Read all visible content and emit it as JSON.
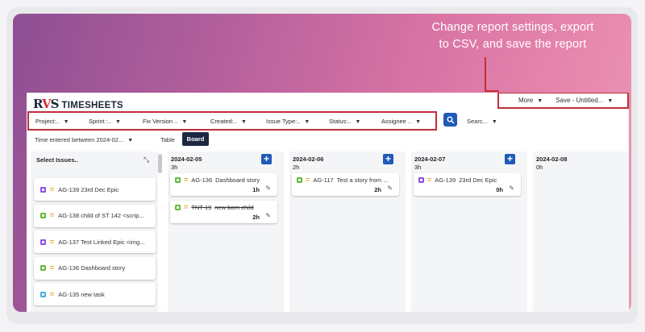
{
  "callout": {
    "line1": "Change report settings, export",
    "line2": "to CSV, and save the report"
  },
  "app": {
    "logo_mark": "RVS",
    "logo_text": "TIMESHEETS",
    "more_label": "More",
    "save_label": "Save - Untitled..."
  },
  "filters": [
    "Project:..",
    "Sprint :..",
    "Fix Version ..",
    "Created:..",
    "Issue Type:..",
    "Status:..",
    "Assignee .."
  ],
  "search_select": "Searc...",
  "time_filter": "Time entered between 2024-02...",
  "views": {
    "table": "Table",
    "board": "Board"
  },
  "issues_panel": {
    "title": "Select Issues..",
    "items": [
      {
        "text": "AG-139 23rd Dec Epic",
        "type_color": "#904ee2"
      },
      {
        "text": "AG-138 child of ST 142 <scrip...",
        "type_color": "#63ba3c"
      },
      {
        "text": "AG-137 Test Linked Epic <img...",
        "type_color": "#904ee2"
      },
      {
        "text": "AG-136 Dashboard story",
        "type_color": "#63ba3c"
      },
      {
        "text": "AG-135 new task",
        "type_color": "#4bade8"
      }
    ]
  },
  "columns": [
    {
      "date": "2024-02-05",
      "total": "3h",
      "cards": [
        {
          "id": "AG-136",
          "title": "Dashboard story",
          "time": "1h",
          "type_color": "#63ba3c",
          "strike": false
        },
        {
          "id": "TNT-19",
          "title": "new born child",
          "time": "2h",
          "type_color": "#63ba3c",
          "strike": true
        }
      ]
    },
    {
      "date": "2024-02-06",
      "total": "2h",
      "cards": [
        {
          "id": "AG-117",
          "title": "Test a story from ...",
          "time": "2h",
          "type_color": "#63ba3c",
          "strike": false
        }
      ]
    },
    {
      "date": "2024-02-07",
      "total": "3h",
      "cards": [
        {
          "id": "AG-139",
          "title": "23rd Dec Epic",
          "time": "0h",
          "type_color": "#904ee2",
          "strike": false
        }
      ]
    },
    {
      "date": "2024-02-08",
      "total": "0h",
      "cards": []
    }
  ],
  "colors": {
    "accent": "#1f5bb7",
    "highlight": "#c0303a",
    "board_active": "#1c2741"
  }
}
